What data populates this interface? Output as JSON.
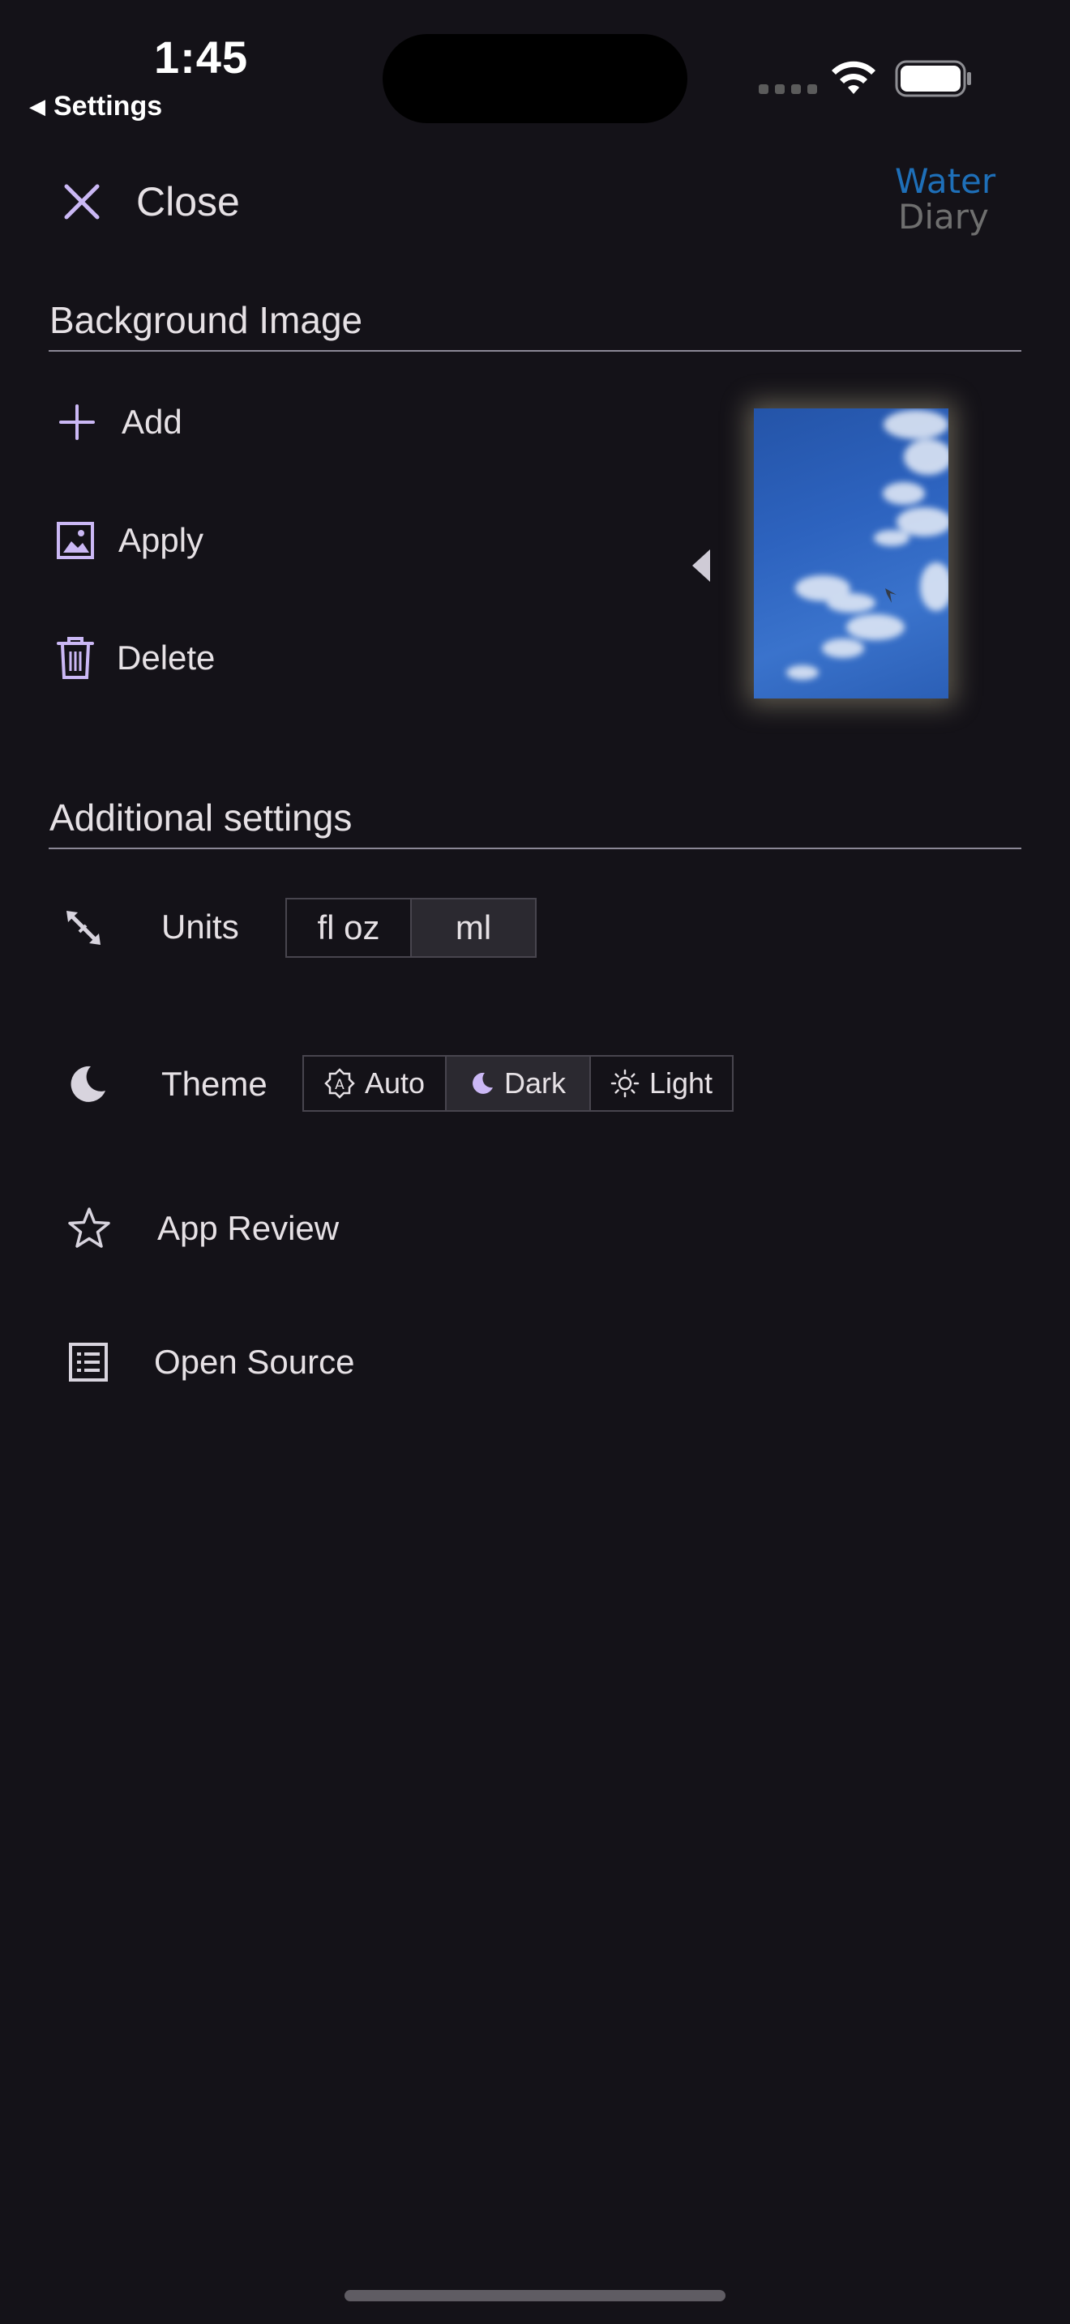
{
  "status_bar": {
    "time": "1:45",
    "back_app": "Settings"
  },
  "header": {
    "close_label": "Close",
    "logo_line1": "Water",
    "logo_line2": "Diary"
  },
  "background_section": {
    "title": "Background Image",
    "actions": [
      {
        "label": "Add",
        "icon": "plus-icon"
      },
      {
        "label": "Apply",
        "icon": "image-apply-icon"
      },
      {
        "label": "Delete",
        "icon": "trash-icon"
      }
    ]
  },
  "additional_section": {
    "title": "Additional settings",
    "units": {
      "label": "Units",
      "options": [
        "fl oz",
        "ml"
      ],
      "selected": "ml"
    },
    "theme": {
      "label": "Theme",
      "options": [
        "Auto",
        "Dark",
        "Light"
      ],
      "selected": "Dark"
    },
    "app_review": "App Review",
    "open_source": "Open Source"
  },
  "colors": {
    "background": "#141218",
    "accent": "#cbb8f5",
    "text": "#e6e1e5",
    "logo_blue": "#1e6fb8"
  }
}
